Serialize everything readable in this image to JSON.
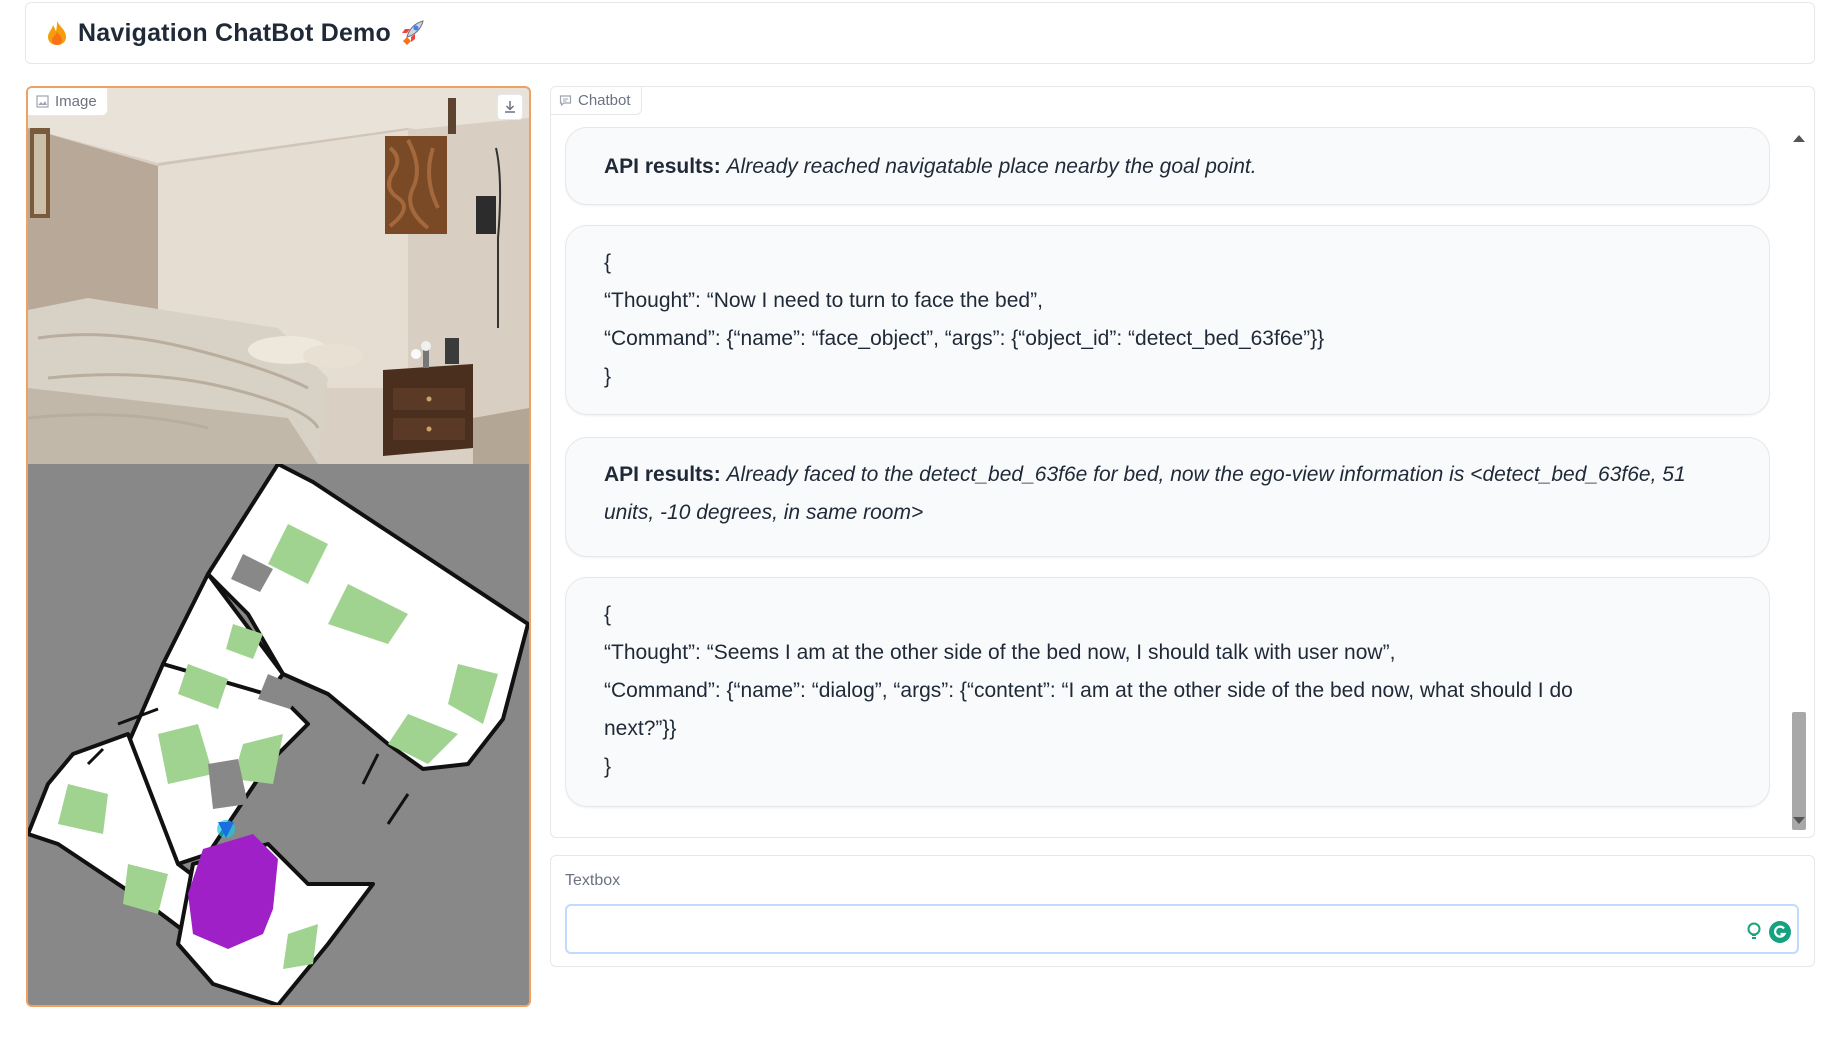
{
  "header": {
    "title": "Navigation ChatBot Demo",
    "left_icon": "flame-icon",
    "right_icon": "rocket-icon"
  },
  "image_panel": {
    "label": "Image",
    "label_icon": "image-icon",
    "download_icon": "download-icon"
  },
  "chat": {
    "label": "Chatbot",
    "label_icon": "chat-icon",
    "messages": [
      {
        "prefix": "API results:",
        "text": "Already reached navigatable place nearby the goal point."
      },
      {
        "lines": [
          "{",
          "“Thought”: “Now I need to turn to face the bed”,",
          "“Command”: {“name”: “face_object”, “args”: {“object_id”: “detect_bed_63f6e”}}",
          "}"
        ]
      },
      {
        "prefix": "API results:",
        "text": "Already faced to the detect_bed_63f6e for bed, now the ego-view information is <detect_bed_63f6e, 51 units, -10 degrees, in same room>"
      },
      {
        "lines": [
          "{",
          "“Thought”: “Seems I am at the other side of the bed now, I should talk with user now”,",
          "“Command”: {“name”: “dialog”, “args”: {“content”: “I am at the other side of the bed now, what should I do",
          "next?”}}",
          "}"
        ]
      }
    ]
  },
  "textbox": {
    "label": "Textbox",
    "value": "",
    "icons": [
      "lightbulb-icon",
      "grammarly-icon"
    ]
  },
  "colors": {
    "accent_border": "#f0a060",
    "map_free": "#ffffff",
    "map_unexplored": "#888888",
    "map_explored": "#9fd38f",
    "map_target": "#a020c8",
    "map_agent": "#1a6fe0"
  }
}
